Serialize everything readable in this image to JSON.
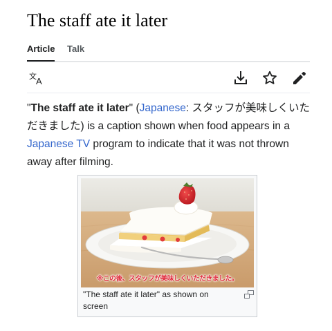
{
  "page": {
    "title": "The staff ate it later"
  },
  "tabs": [
    {
      "label": "Article",
      "active": true
    },
    {
      "label": "Talk",
      "active": false
    }
  ],
  "toolbar": {
    "icons": [
      "language-icon",
      "download-icon",
      "star-icon",
      "edit-pencil-icon"
    ]
  },
  "intro": {
    "q_open": "\"",
    "term": "The staff ate it later",
    "q_close": "\"",
    "paren_open": " (",
    "lang_link": "Japanese",
    "jp_text": ": スタッフが美味しくいただきました",
    "text_after": ") is a caption shown when food appears in a ",
    "tv_link": "Japanese TV",
    "text_end": " program to indicate that it was not thrown away after filming."
  },
  "figure": {
    "image_subtitle": "※この後、スタッフが美味しくいただきました。",
    "caption": "\"The staff ate it later\" as shown on screen"
  },
  "colors": {
    "link": "#3366cc",
    "text": "#202122",
    "subtitle": "#e0293a"
  }
}
